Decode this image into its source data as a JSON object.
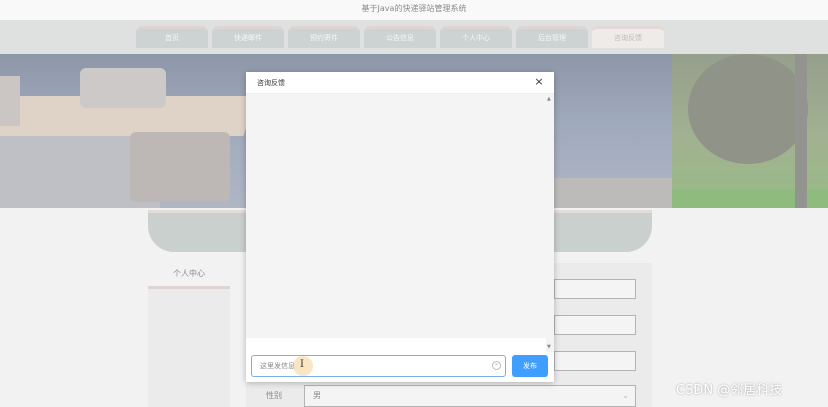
{
  "site": {
    "title": "基于Java的快递驿站管理系统"
  },
  "nav": {
    "items": [
      {
        "label": "首页",
        "active": false
      },
      {
        "label": "快递邮件",
        "active": false
      },
      {
        "label": "预约寄件",
        "active": false
      },
      {
        "label": "公告信息",
        "active": false
      },
      {
        "label": "个人中心",
        "active": false
      },
      {
        "label": "后台管理",
        "active": false
      },
      {
        "label": "咨询反馈",
        "active": true
      }
    ]
  },
  "sidebar": {
    "item_label": "个人中心"
  },
  "form": {
    "gender_label": "性别",
    "gender_value": "男"
  },
  "modal": {
    "title": "咨询反馈",
    "close_symbol": "×",
    "input_placeholder": "这里发信息",
    "send_label": "发布"
  },
  "watermark": "CSDN @邻居科技",
  "colors": {
    "accent": "#409eff",
    "nav_bar": "#c8cbcb",
    "nav_tab": "#a9b3b3"
  }
}
